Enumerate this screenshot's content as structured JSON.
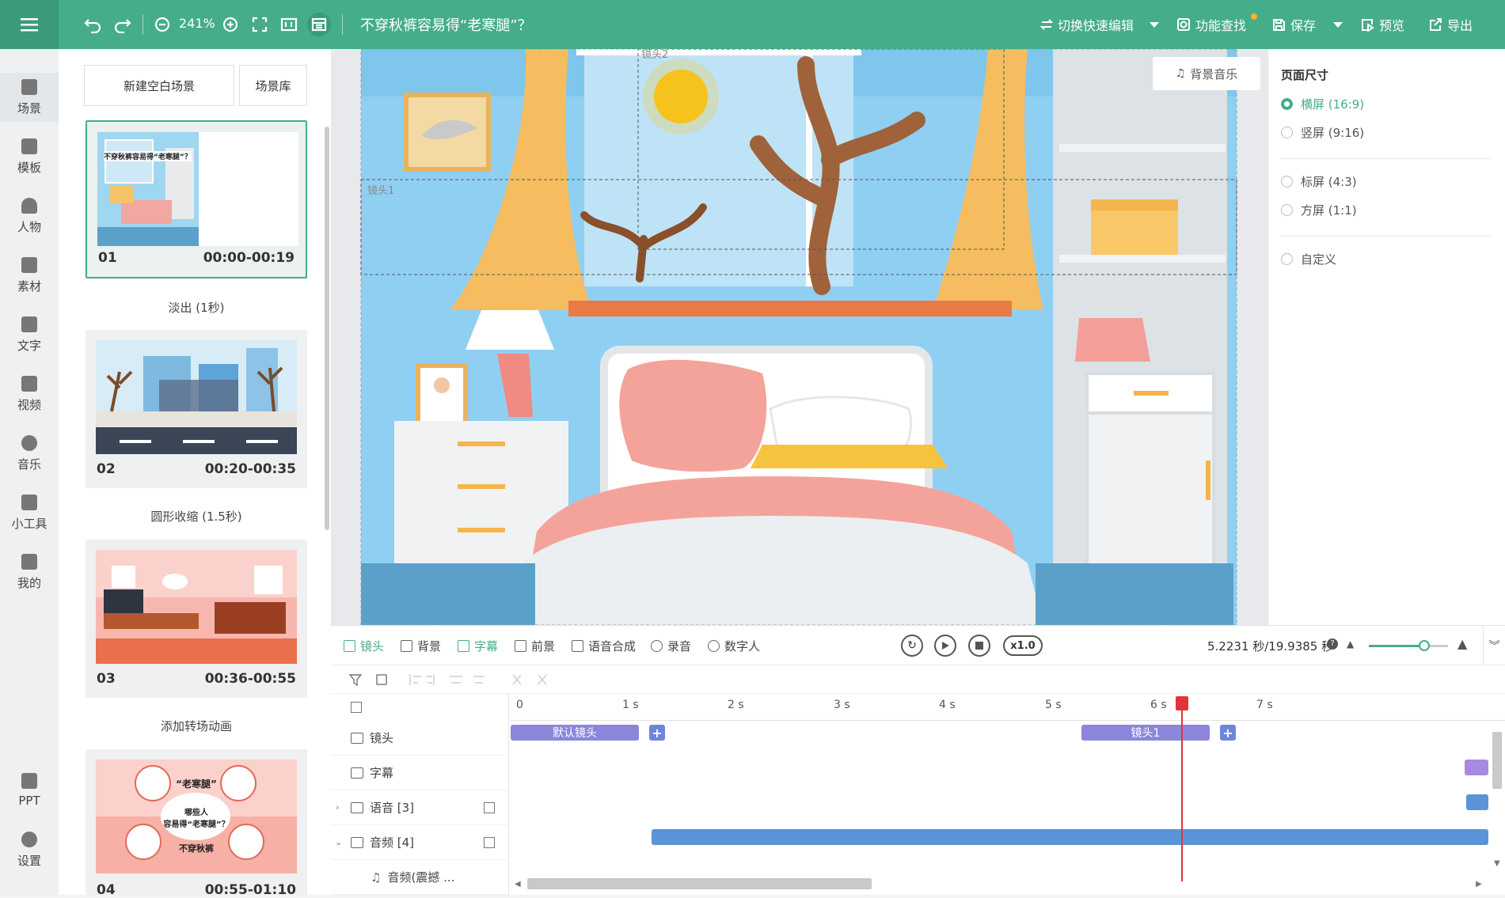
{
  "topbar": {
    "zoom": "241%",
    "title": "不穿秋裤容易得“老寒腿”？",
    "switch_edit": "切换快速编辑",
    "find": "功能查找",
    "save": "保存",
    "preview": "预览",
    "export": "导出",
    "colors": {
      "bar": "#45ad8a",
      "menu": "#3a9a7a"
    }
  },
  "nav": [
    {
      "label": "场景"
    },
    {
      "label": "模板"
    },
    {
      "label": "人物"
    },
    {
      "label": "素材"
    },
    {
      "label": "文字"
    },
    {
      "label": "视频"
    },
    {
      "label": "音乐"
    },
    {
      "label": "小工具"
    },
    {
      "label": "我的"
    },
    {
      "label": "PPT"
    },
    {
      "label": "设置"
    }
  ],
  "scene_panel": {
    "new_blank": "新建空白场景",
    "library": "场景库",
    "scenes": [
      {
        "num": "01",
        "time": "00:00-00:19",
        "thumb_text": "不穿秋裤容易得“老寒腿”？"
      },
      {
        "num": "02",
        "time": "00:20-00:35"
      },
      {
        "num": "03",
        "time": "00:36-00:55"
      },
      {
        "num": "04",
        "time": "00:55-01:10",
        "thumb_title": "“老寒腿”",
        "thumb_sub": "哪些人\n容易得“老寒腿”？",
        "thumb_bottom": "不穿秋裤"
      }
    ],
    "transitions": [
      "淡出 (1秒)",
      "圆形收缩 (1.5秒)",
      "添加转场动画"
    ]
  },
  "canvas": {
    "camera2": "镜头2",
    "camera1": "镜头1",
    "bg_music": "背景音乐"
  },
  "right_panel": {
    "title": "页面尺寸",
    "options": [
      {
        "label": "横屏 (16:9)",
        "checked": true
      },
      {
        "label": "竖屏 (9:16)",
        "checked": false
      },
      {
        "label": "标屏 (4:3)",
        "checked": false
      },
      {
        "label": "方屏 (1:1)",
        "checked": false
      },
      {
        "label": "自定义",
        "checked": false
      }
    ]
  },
  "timeline": {
    "tabs": [
      {
        "label": "镜头",
        "active": true
      },
      {
        "label": "背景",
        "active": false
      },
      {
        "label": "字幕",
        "active": true
      },
      {
        "label": "前景",
        "active": false
      },
      {
        "label": "语音合成",
        "active": false
      },
      {
        "label": "录音",
        "active": false
      },
      {
        "label": "数字人",
        "active": false
      }
    ],
    "speed": "x1.0",
    "time": "5.2231 秒/19.9385 秒",
    "zoom_level": 0.7,
    "ruler": [
      "0",
      "1 s",
      "2 s",
      "3 s",
      "4 s",
      "5 s",
      "6 s",
      "7 s"
    ],
    "tracks": [
      {
        "label": "镜头"
      },
      {
        "label": "字幕"
      },
      {
        "label": "语音 [3]"
      },
      {
        "label": "音频 [4]"
      },
      {
        "label": "音频(震撼 ..."
      }
    ],
    "clips": {
      "default_cam": "默认镜头",
      "cam1": "镜头1"
    },
    "playhead_seconds": 5.2231
  }
}
